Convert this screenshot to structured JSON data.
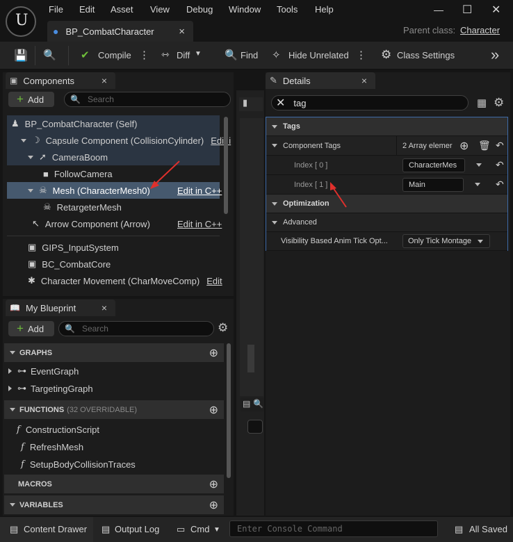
{
  "menu": [
    "File",
    "Edit",
    "Asset",
    "View",
    "Debug",
    "Window",
    "Tools",
    "Help"
  ],
  "document_tab": {
    "title": "BP_CombatCharacter",
    "close": "×"
  },
  "parent_class": {
    "label": "Parent class:",
    "value": "Character"
  },
  "toolbar": {
    "compile": "Compile",
    "diff": "Diff",
    "find": "Find",
    "hide_unrelated": "Hide Unrelated",
    "class_settings": "Class Settings"
  },
  "components": {
    "tab_title": "Components",
    "add": "Add",
    "search_placeholder": "Search",
    "tree": [
      {
        "label": "BP_CombatCharacter (Self)",
        "edit": ""
      },
      {
        "label": "Capsule Component (CollisionCylinder)",
        "edit": "Edit i"
      },
      {
        "label": "CameraBoom",
        "edit": ""
      },
      {
        "label": "FollowCamera",
        "edit": ""
      },
      {
        "label": "Mesh (CharacterMesh0)",
        "edit": "Edit in C++"
      },
      {
        "label": "RetargeterMesh",
        "edit": ""
      },
      {
        "label": "Arrow Component (Arrow)",
        "edit": "Edit in C++"
      },
      {
        "label": "GIPS_InputSystem",
        "edit": ""
      },
      {
        "label": "BC_CombatCore",
        "edit": ""
      },
      {
        "label": "Character Movement (CharMoveComp)",
        "edit": "Edit"
      }
    ]
  },
  "my_blueprint": {
    "tab_title": "My Blueprint",
    "add": "Add",
    "search_placeholder": "Search",
    "graphs_header": "GRAPHS",
    "graphs": [
      "EventGraph",
      "TargetingGraph"
    ],
    "functions_header": "FUNCTIONS",
    "functions_count": "(32 OVERRIDABLE)",
    "functions": [
      "ConstructionScript",
      "RefreshMesh",
      "SetupBodyCollisionTraces"
    ],
    "macros_header": "MACROS",
    "variables_header": "VARIABLES"
  },
  "details": {
    "tab_title": "Details",
    "search_value": "tag",
    "tags_section": "Tags",
    "component_tags_label": "Component Tags",
    "component_tags_value": "2 Array elemer",
    "index0_label": "Index [ 0 ]",
    "index0_value": "CharacterMes",
    "index1_label": "Index [ 1 ]",
    "index1_value": "Main",
    "optimization_section": "Optimization",
    "advanced_label": "Advanced",
    "visibility_label": "Visibility Based Anim Tick Opt...",
    "visibility_value": "Only Tick Montage"
  },
  "bottom": {
    "content_drawer": "Content Drawer",
    "output_log": "Output Log",
    "cmd": "Cmd",
    "console_placeholder": "Enter Console Command",
    "saved": "All Saved"
  },
  "colors": {
    "selection": "#46596e",
    "annotation_arrow": "#e0302c",
    "add_icon": "#6fbf3a"
  }
}
